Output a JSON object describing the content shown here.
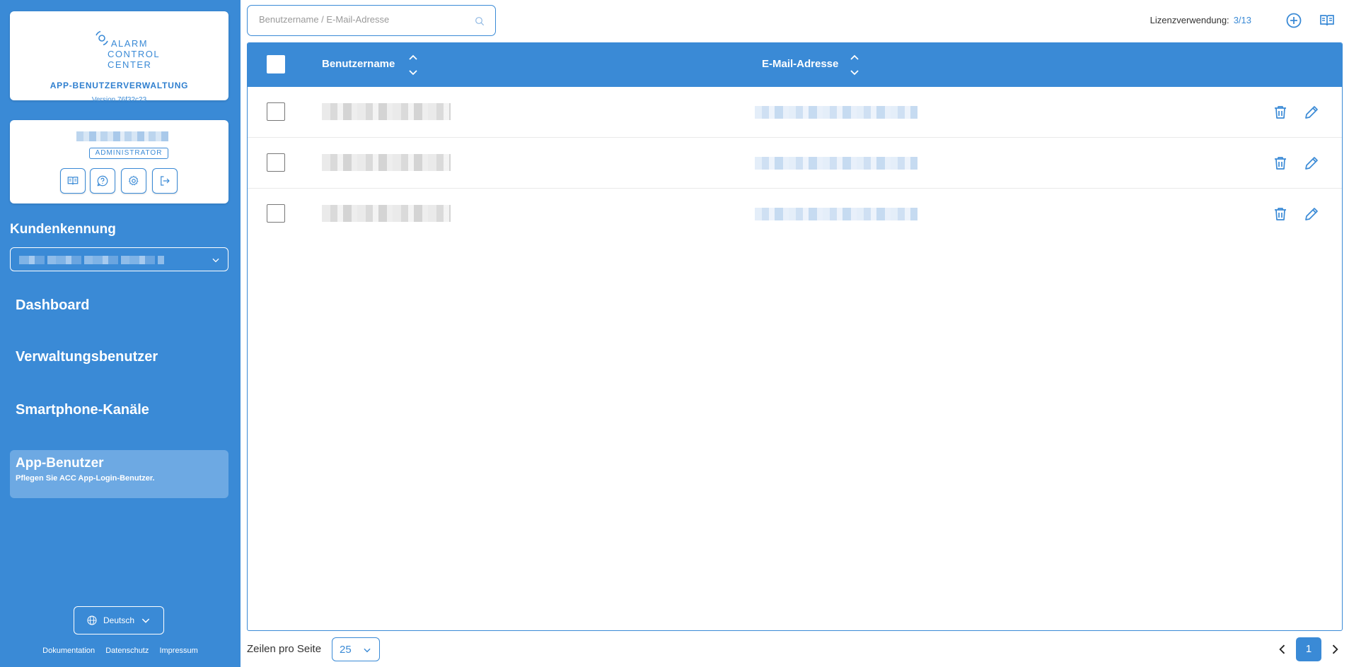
{
  "brand": {
    "logo_lines": [
      "ALARM",
      "CONTROL",
      "CENTER"
    ],
    "app_title": "APP-BENUTZERVERWALTUNG",
    "version": "Version 76f32c23"
  },
  "user": {
    "role": "ADMINISTRATOR",
    "actions": [
      "documentation-icon",
      "help-icon",
      "settings-icon",
      "logout-icon"
    ]
  },
  "customer": {
    "label": "Kundenkennung"
  },
  "nav": {
    "items": [
      {
        "label": "Dashboard"
      },
      {
        "label": "Verwaltungsbenutzer"
      },
      {
        "label": "Smartphone-Kanäle"
      }
    ],
    "active": {
      "label": "App-Benutzer",
      "subtitle": "Pflegen Sie ACC App-Login-Benutzer."
    }
  },
  "language": {
    "current": "Deutsch"
  },
  "footer": {
    "links": [
      "Dokumentation",
      "Datenschutz",
      "Impressum"
    ]
  },
  "search": {
    "placeholder": "Benutzername / E-Mail-Adresse"
  },
  "license": {
    "label": "Lizenzverwendung:",
    "value": "3/13"
  },
  "table": {
    "columns": [
      "Benutzername",
      "E-Mail-Adresse"
    ],
    "row_count": 3
  },
  "pagination": {
    "rows_label": "Zeilen pro Seite",
    "page_size": "25",
    "current_page": "1"
  },
  "colors": {
    "primary": "#3a8ad6",
    "sidebar_active": "#6da9e3"
  }
}
